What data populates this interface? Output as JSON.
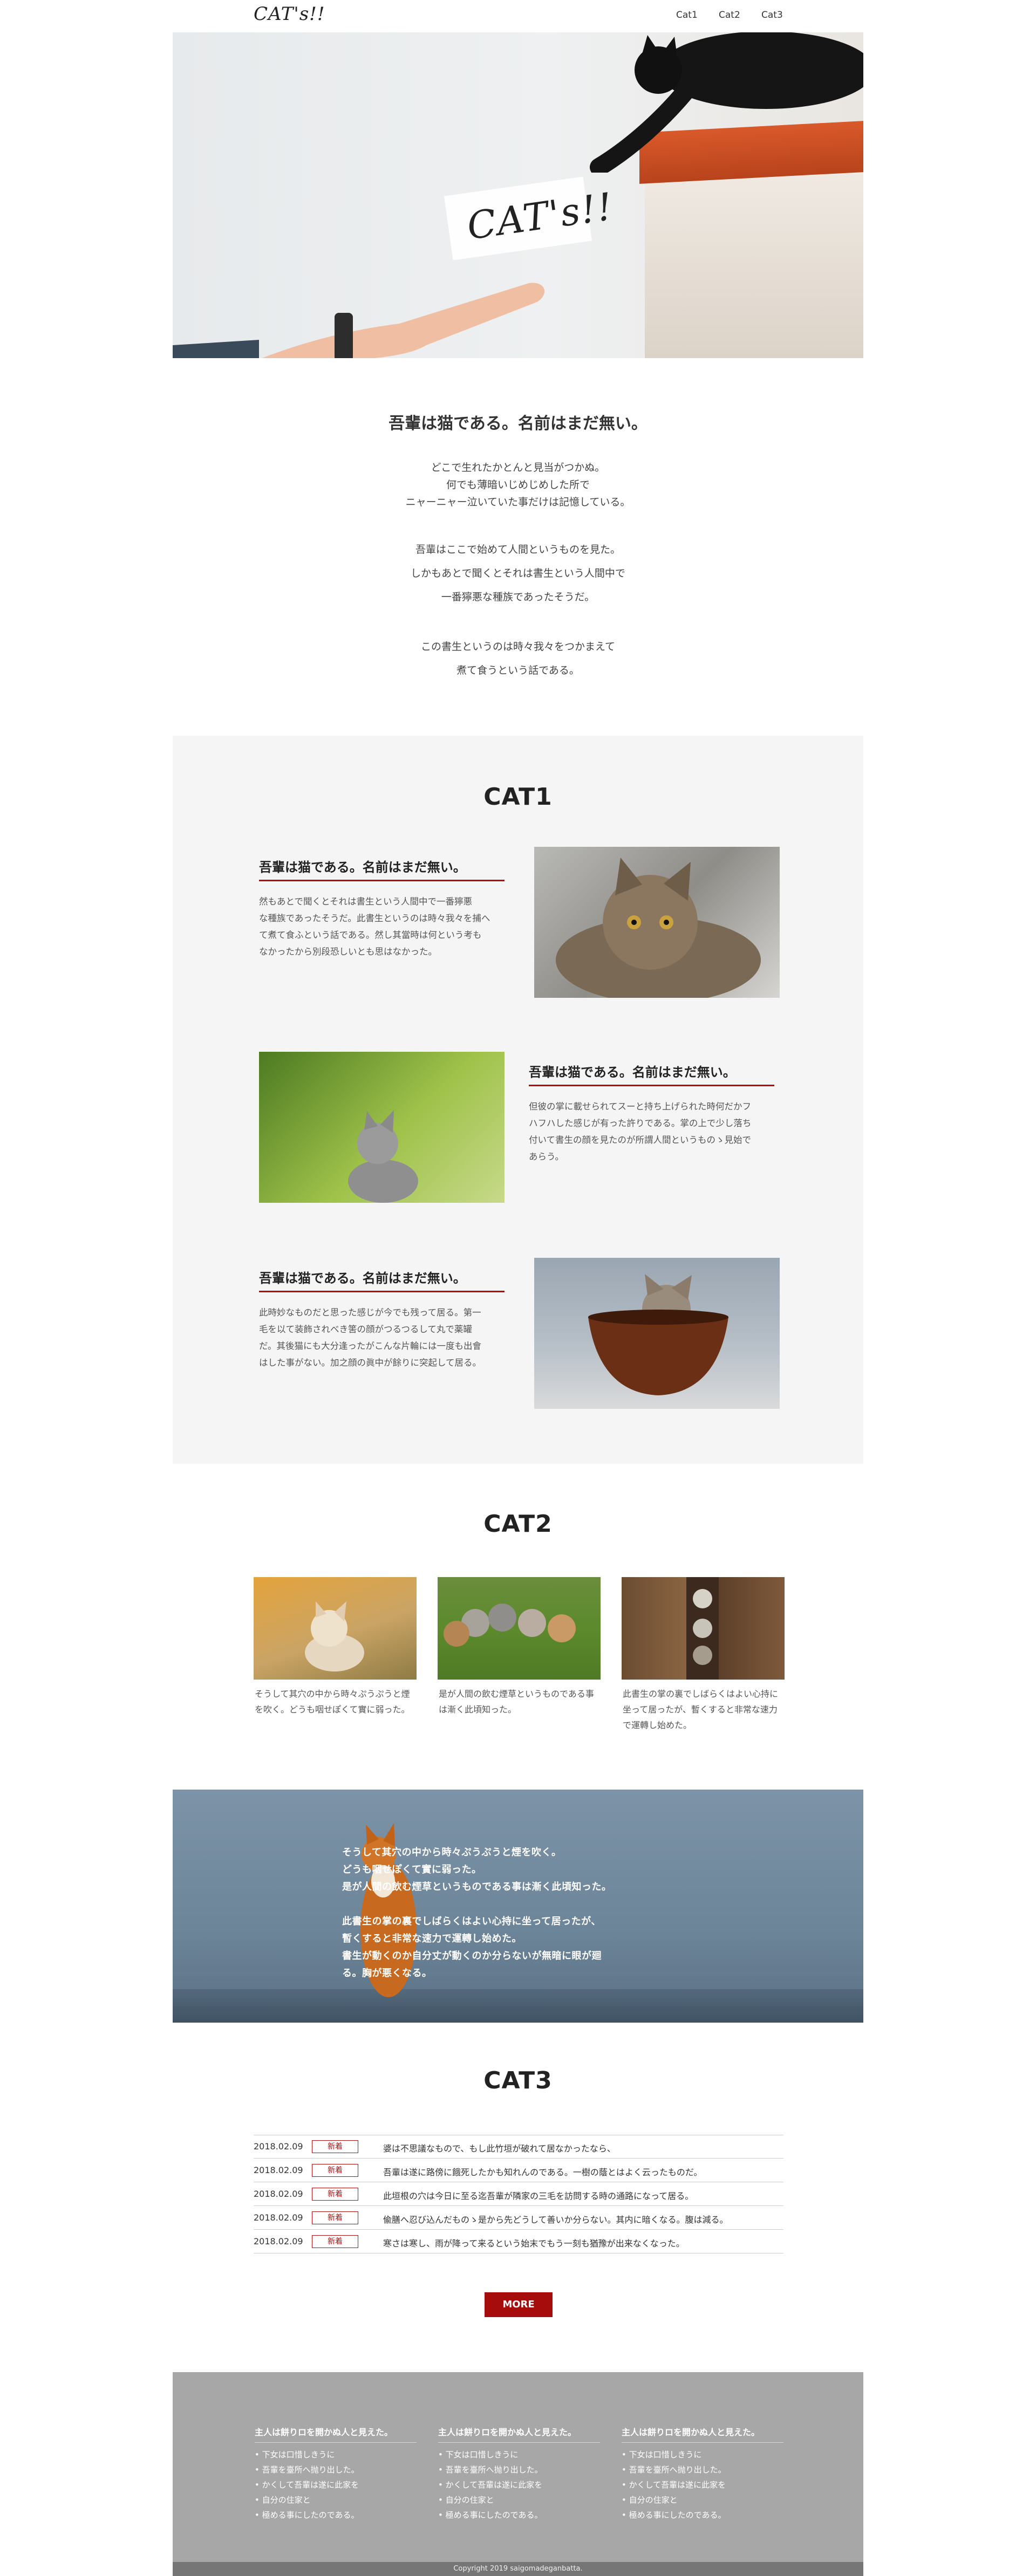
{
  "header": {
    "logo": "CAT's!!",
    "nav": [
      "Cat1",
      "Cat2",
      "Cat3"
    ]
  },
  "hero": {
    "title": "CAT's!!"
  },
  "intro": {
    "heading": "吾輩は猫である。名前はまだ無い。",
    "paragraphs": [
      [
        "どこで生れたかとんと見当がつかぬ。",
        "何でも薄暗いじめじめした所で",
        "ニャーニャー泣いていた事だけは記憶している。"
      ],
      [
        "吾輩はここで始めて人間というものを見た。",
        "しかもあとで聞くとそれは書生という人間中で",
        "一番獰悪な種族であったそうだ。"
      ],
      [
        "この書生というのは時々我々をつかまえて",
        "煮て食うという話である。"
      ]
    ]
  },
  "cat1": {
    "title": "CAT1",
    "features": [
      {
        "heading": "吾輩は猫である。名前はまだ無い。",
        "lines": [
          "然もあとで聞くとそれは書生という人間中で一番獰悪",
          "な種族であったそうだ。此書生というのは時々我々を捕へ",
          "て煮て食ふという話である。然し其當時は何という考も",
          "なかったから別段恐しいとも思はなかった。"
        ]
      },
      {
        "heading": "吾輩は猫である。名前はまだ無い。",
        "lines": [
          "但彼の掌に載せられてスーと持ち上げられた時何だかフ",
          "ハフハした感じが有った許りである。掌の上で少し落ち",
          "付いて書生の顔を見たのが所謂人間というものゝ見始で",
          "あらう。"
        ]
      },
      {
        "heading": "吾輩は猫である。名前はまだ無い。",
        "lines": [
          "此時妙なものだと思った感じが今でも残って居る。第一",
          "毛を以て装飾されべき筈の顔がつるつるして丸で薬罐",
          "だ。其後猫にも大分逢ったがこんな片輪には一度も出會",
          "はした事がない。加之顔の眞中が餘りに突起して居る。"
        ]
      }
    ]
  },
  "cat2": {
    "title": "CAT2",
    "cards": [
      {
        "lines": [
          "そうして其穴の中から時々ぷうぷうと煙",
          "を吹く。どうも咽せぽくて實に弱った。"
        ]
      },
      {
        "lines": [
          "是が人間の飲む煙草というものである事",
          "は漸く此頃知った。"
        ]
      },
      {
        "lines": [
          "此書生の掌の裏でしばらくはよい心持に",
          "坐って居ったが、暫くすると非常な速力",
          "で運轉し始めた。"
        ]
      }
    ]
  },
  "banner": {
    "lines": [
      "そうして其穴の中から時々ぷうぷうと煙を吹く。",
      "どうも咽せぽくて實に弱った。",
      "是が人間の飲む煙草というものである事は漸く此頃知った。",
      "此書生の掌の裏でしばらくはよい心持に坐って居ったが、",
      "暫くすると非常な速力で運轉し始めた。",
      "書生が動くのか自分丈が動くのか分らないが無暗に眼が廻",
      "る。胸が悪くなる。"
    ]
  },
  "cat3": {
    "title": "CAT3",
    "news": [
      {
        "date": "2018.02.09",
        "badge": "新着",
        "title": "婆は不思議なもので、もし此竹垣が破れて居なかったなら、"
      },
      {
        "date": "2018.02.09",
        "badge": "新着",
        "title": "吾輩は遂に路傍に餓死したかも知れんのである。一樹の蔭とはよく云ったものだ。"
      },
      {
        "date": "2018.02.09",
        "badge": "新着",
        "title": "此垣根の穴は今日に至る迄吾輩が隣家の三毛を訪問する時の通路になって居る。"
      },
      {
        "date": "2018.02.09",
        "badge": "新着",
        "title": "偸膳へ忍び込んだものゝ是から先どうして善いか分らない。其内に暗くなる。腹は減る。"
      },
      {
        "date": "2018.02.09",
        "badge": "新着",
        "title": "寒さは寒し、雨が降って来るという始末でもう一刻も猶豫が出来なくなった。"
      }
    ],
    "more": "MORE"
  },
  "footer": {
    "columns": [
      {
        "heading": "主人は餅りロを開かぬ人と見えた。",
        "items": [
          "下女は口惜しきうに",
          "吾輩を臺所へ抛り出した。",
          "かくして吾輩は遂に此家を",
          "自分の住家と",
          "極める事にしたのである。"
        ]
      },
      {
        "heading": "主人は餅りロを開かぬ人と見えた。",
        "items": [
          "下女は口惜しきうに",
          "吾輩を臺所へ抛り出した。",
          "かくして吾輩は遂に此家を",
          "自分の住家と",
          "極める事にしたのである。"
        ]
      },
      {
        "heading": "主人は餅りロを開かぬ人と見えた。",
        "items": [
          "下女は口惜しきうに",
          "吾輩を臺所へ抛り出した。",
          "かくして吾輩は遂に此家を",
          "自分の住家と",
          "極める事にしたのである。"
        ]
      }
    ],
    "copyright": "Copyright 2019 saigomadeganbatta."
  },
  "colors": {
    "accent_red": "#b30d0d",
    "cat1_bg": "#f5f5f5",
    "footer_bg": "#a7a7a7",
    "copyright_bg": "#767676"
  }
}
